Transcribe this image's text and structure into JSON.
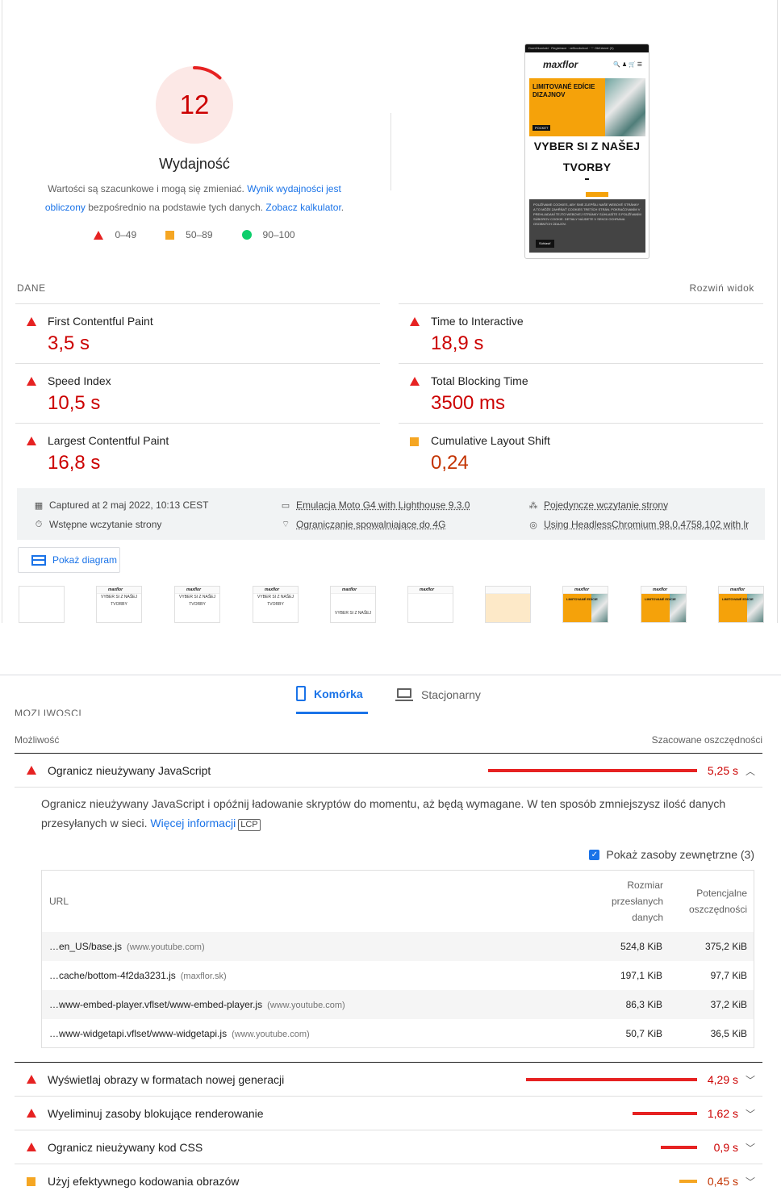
{
  "summary": {
    "score": "12",
    "score_fraction": 0.12,
    "title": "Wydajność",
    "desc_prefix": "Wartości są szacunkowe i mogą się zmieniać. ",
    "desc_link1": "Wynik wydajności jest obliczony",
    "desc_mid": " bezpośrednio na podstawie tych danych. ",
    "desc_link2": "Zobacz kalkulator",
    "desc_end": ".",
    "legend": {
      "red": "0–49",
      "orange": "50–89",
      "green": "90–100"
    },
    "colors": {
      "fail": "#e62222",
      "average": "#f5a623",
      "pass": "#0cce6b",
      "link": "#1a73e8"
    }
  },
  "screenshot": {
    "topbar": "Domů/kontakt · Registrace · veľkoobchod  ·  ♡ Obľúbené (0)",
    "logo": "maxflor",
    "banner_text": "LIMITOVANÉ EDÍCIE DIZAJNOV",
    "banner_btn": "POCKET",
    "headline1": "VYBER SI Z NAŠEJ",
    "headline2": "TVORBY",
    "cookie_text": "POUŽÍVAME COOKIES, ABY SME ZLEPŠILI NAŠE WEBOVÉ STRÁNKY A TO MÔŽE ZAHŔŇAŤ COOKIES TRETÍCH STRÁN. POKRAČOVANÍM V PREHLIADANÍ TEJTO WEBOVEJ STRÁNKY SÚHLASÍTE S POUŽÍVANÍM SÚBOROV COOKIE. DETAILY NÁJDETE V SEKCII OCHRANA OSOBNÝCH ÚDAJOV.",
    "cookie_btn": "Súhlasiť"
  },
  "metrics": {
    "section_label": "DANE",
    "expand": "Rozwiń widok",
    "items": [
      {
        "name": "First Contentful Paint",
        "value": "3,5 s",
        "status": "fail"
      },
      {
        "name": "Time to Interactive",
        "value": "18,9 s",
        "status": "fail"
      },
      {
        "name": "Speed Index",
        "value": "10,5 s",
        "status": "fail"
      },
      {
        "name": "Total Blocking Time",
        "value": "3500 ms",
        "status": "fail"
      },
      {
        "name": "Largest Contentful Paint",
        "value": "16,8 s",
        "status": "fail"
      },
      {
        "name": "Cumulative Layout Shift",
        "value": "0,24",
        "status": "average"
      }
    ]
  },
  "info": {
    "captured": "Captured at 2 maj 2022, 10:13 CEST",
    "initial_load": "Wstępne wczytanie strony",
    "emulation": "Emulacja Moto G4 with Lighthouse 9.3.0",
    "throttling": "Ograniczanie spowalniające do 4G",
    "single_load": "Pojedyncze wczytanie strony",
    "browser": "Using HeadlessChromium 98.0.4758.102 with lr"
  },
  "diagram_button": "Pokaż diagram",
  "filmstrip": {
    "heading": "VYBER SI Z NAŠEJ",
    "sub": "TVORBY",
    "sale": "LIMITOVANÉ EDÍCIE"
  },
  "tabs": {
    "mobile": "Komórka",
    "desktop": "Stacjonarny"
  },
  "opportunities": {
    "cutoff_heading": "MOŻLIWOŚCI",
    "col_left": "Możliwość",
    "col_right": "Szacowane oszczędności",
    "expanded": {
      "title": "Ogranicz nieużywany JavaScript",
      "value": "5,25 s",
      "bar_fraction": 0.308,
      "desc": "Ogranicz nieużywany JavaScript i opóźnij ładowanie skryptów do momentu, aż będą wymagane. W ten sposób zmniejszysz ilość danych przesyłanych w sieci. ",
      "more_link": "Więcej informacji",
      "badge": "LCP",
      "third_party_label": "Pokaż zasoby zewnętrzne (3)",
      "table": {
        "col_url": "URL",
        "col_size_1": "Rozmiar",
        "col_size_2": "przesłanych",
        "col_size_3": "danych",
        "col_save_1": "Potencjalne",
        "col_save_2": "oszczędności",
        "rows": [
          {
            "url": "…en_US/base.js",
            "host": "(www.youtube.com)",
            "size": "524,8 KiB",
            "savings": "375,2 KiB"
          },
          {
            "url": "…cache/bottom-4f2da3231.js",
            "host": "(maxflor.sk)",
            "size": "197,1 KiB",
            "savings": "97,7 KiB"
          },
          {
            "url": "…www-embed-player.vflset/www-embed-player.js",
            "host": "(www.youtube.com)",
            "size": "86,3 KiB",
            "savings": "37,2 KiB"
          },
          {
            "url": "…www-widgetapi.vflset/www-widgetapi.js",
            "host": "(www.youtube.com)",
            "size": "50,7 KiB",
            "savings": "36,5 KiB"
          }
        ]
      }
    },
    "rows": [
      {
        "title": "Wyświetlaj obrazy w formatach nowej generacji",
        "value": "4,29 s",
        "status": "fail",
        "bar_fraction": 0.252
      },
      {
        "title": "Wyeliminuj zasoby blokujące renderowanie",
        "value": "1,62 s",
        "status": "fail",
        "bar_fraction": 0.095
      },
      {
        "title": "Ogranicz nieużywany kod CSS",
        "value": "0,9 s",
        "status": "fail",
        "bar_fraction": 0.053
      },
      {
        "title": "Użyj efektywnego kodowania obrazów",
        "value": "0,45 s",
        "status": "average",
        "bar_fraction": 0.026
      }
    ]
  }
}
